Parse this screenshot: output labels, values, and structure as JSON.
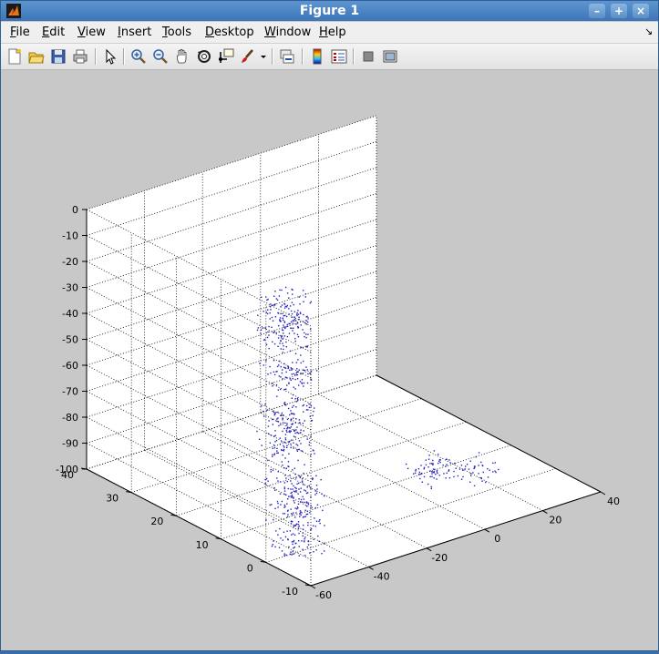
{
  "window": {
    "title": "Figure 1",
    "buttons": [
      "minimize",
      "maximize",
      "close"
    ],
    "menu_corner_glyph": "↘"
  },
  "menu": [
    {
      "prefix": "",
      "u": "F",
      "rest": "ile"
    },
    {
      "prefix": "",
      "u": "E",
      "rest": "dit"
    },
    {
      "prefix": "",
      "u": "V",
      "rest": "iew"
    },
    {
      "prefix": "",
      "u": "I",
      "rest": "nsert"
    },
    {
      "prefix": "",
      "u": "T",
      "rest": "ools"
    },
    {
      "prefix": "",
      "u": "D",
      "rest": "esktop"
    },
    {
      "prefix": "",
      "u": "W",
      "rest": "indow"
    },
    {
      "prefix": "",
      "u": "H",
      "rest": "elp"
    }
  ],
  "toolbar": [
    "new-figure-icon",
    "open-file-icon",
    "save-icon",
    "print-icon",
    "edit-plot-icon",
    "zoom-in-icon",
    "zoom-out-icon",
    "pan-icon",
    "rotate-3d-icon",
    "data-cursor-icon",
    "brush-icon",
    "link-plot-icon",
    "colorbar-icon",
    "legend-icon",
    "hide-plot-tools-icon",
    "show-plot-tools-icon"
  ],
  "chart_data": {
    "type": "scatter",
    "view": "3d",
    "title": "",
    "xlabel": "",
    "ylabel": "",
    "zlabel": "",
    "xlim": [
      -60,
      40
    ],
    "ylim": [
      -10,
      40
    ],
    "zlim": [
      -100,
      0
    ],
    "x_ticks": [
      "-60",
      "-40",
      "-20",
      "0",
      "20",
      "40"
    ],
    "y_ticks": [
      "-10",
      "0",
      "10",
      "20",
      "30",
      "40"
    ],
    "z_ticks": [
      "0",
      "-10",
      "-20",
      "-30",
      "-40",
      "-50",
      "-60",
      "-70",
      "-80",
      "-90",
      "-100"
    ],
    "grid": true,
    "marker_color": "#2020c0",
    "clusters_xy": [
      {
        "x": -50,
        "y": 0,
        "z": -98
      },
      {
        "x": -42,
        "y": 5,
        "z": -92
      },
      {
        "x": -38,
        "y": 8,
        "z": -85
      },
      {
        "x": -30,
        "y": 15,
        "z": -78
      },
      {
        "x": -25,
        "y": 18,
        "z": -72
      },
      {
        "x": -18,
        "y": 22,
        "z": -62
      },
      {
        "x": -14,
        "y": 26,
        "z": -52
      },
      {
        "x": -10,
        "y": 28,
        "z": -45
      },
      {
        "x": 10,
        "y": 8,
        "z": -98
      },
      {
        "x": 20,
        "y": 5,
        "z": -100
      }
    ]
  }
}
